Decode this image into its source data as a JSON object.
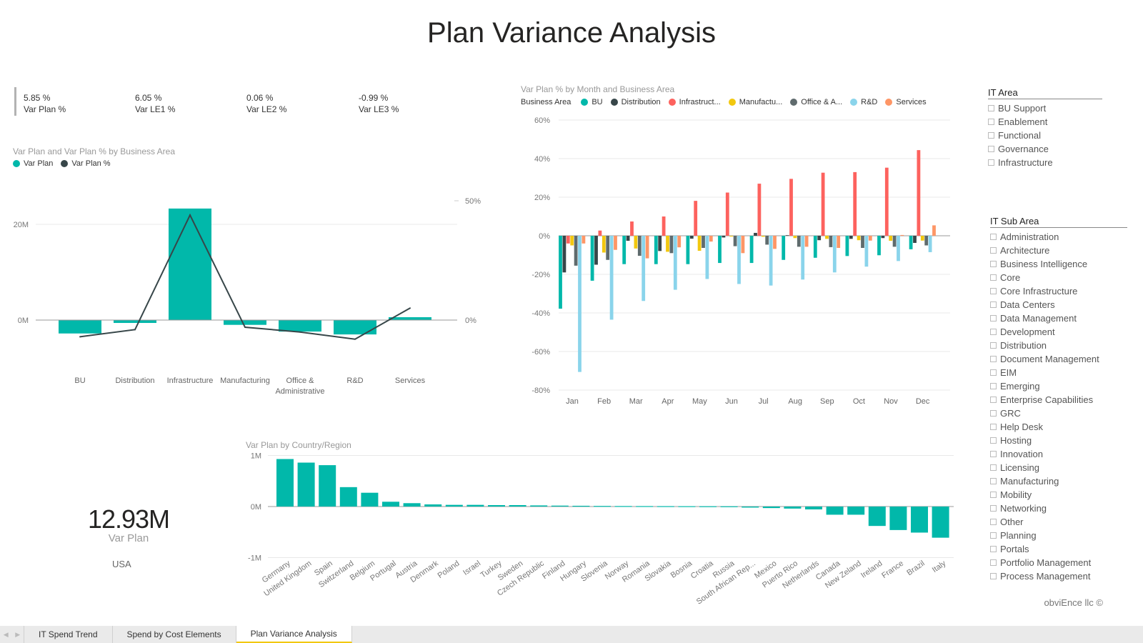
{
  "report": {
    "title": "Plan Variance Analysis",
    "credit": "obviEnce llc ©"
  },
  "colors": {
    "teal": "#01B8AA",
    "dark": "#374649",
    "red": "#FD625E",
    "yellow": "#F2C80F",
    "gray": "#5F6B6D",
    "lightblue": "#8AD4EB",
    "orange": "#FE9666",
    "tab_active": "#F2C811"
  },
  "kpis": [
    {
      "value": "5.85 %",
      "label": "Var Plan %"
    },
    {
      "value": "6.05 %",
      "label": "Var LE1 %"
    },
    {
      "value": "0.06 %",
      "label": "Var LE2 %"
    },
    {
      "value": "-0.99 %",
      "label": "Var LE3 %"
    }
  ],
  "big_card": {
    "value": "12.93M",
    "label": "Var Plan",
    "filter_label": "USA"
  },
  "slicers": {
    "it_area": {
      "title": "IT Area",
      "items": [
        "BU Support",
        "Enablement",
        "Functional",
        "Governance",
        "Infrastructure"
      ]
    },
    "it_sub_area": {
      "title": "IT Sub Area",
      "items": [
        "Administration",
        "Architecture",
        "Business Intelligence",
        "Core",
        "Core Infrastructure",
        "Data Centers",
        "Data Management",
        "Development",
        "Distribution",
        "Document Management",
        "EIM",
        "Emerging",
        "Enterprise Capabilities",
        "GRC",
        "Help Desk",
        "Hosting",
        "Innovation",
        "Licensing",
        "Manufacturing",
        "Mobility",
        "Networking",
        "Other",
        "Planning",
        "Portals",
        "Portfolio Management",
        "Process Management"
      ]
    }
  },
  "tabs": {
    "items": [
      "IT Spend Trend",
      "Spend by Cost Elements",
      "Plan Variance Analysis"
    ],
    "active": 2
  },
  "chart_data": [
    {
      "id": "combo",
      "type": "bar",
      "title": "Var Plan and Var Plan % by Business Area",
      "legend": [
        "Var Plan",
        "Var Plan %"
      ],
      "legend_position": "top-left",
      "categories": [
        "BU",
        "Distribution",
        "Infrastructure",
        "Manufacturing",
        "Office & Administrative",
        "R&D",
        "Services"
      ],
      "category_lines": [
        [
          "BU"
        ],
        [
          "Distribution"
        ],
        [
          "Infrastructure"
        ],
        [
          "Manufacturing"
        ],
        [
          "Office &",
          "Administrative"
        ],
        [
          "R&D"
        ],
        [
          "Services"
        ]
      ],
      "series": [
        {
          "name": "Var Plan",
          "type": "bar",
          "axis": "left",
          "unit": "M",
          "values": [
            -2.8,
            -0.6,
            23.3,
            -1.0,
            -2.4,
            -3.0,
            0.6
          ]
        },
        {
          "name": "Var Plan %",
          "type": "line",
          "axis": "right",
          "unit": "%",
          "values": [
            -7,
            -4,
            44,
            -3,
            -5,
            -8,
            5
          ]
        }
      ],
      "y_left": {
        "ticks": [
          0,
          20
        ],
        "tick_labels": [
          "0M",
          "20M"
        ],
        "range": [
          -12,
          26
        ]
      },
      "y_right": {
        "ticks": [
          0,
          50
        ],
        "tick_labels": [
          "0%",
          "50%"
        ]
      },
      "grid": true
    },
    {
      "id": "monthly",
      "type": "bar",
      "title": "Var Plan % by Month and Business Area",
      "legend_title": "Business Area",
      "legend_position": "top-left",
      "legend": [
        "BU",
        "Distribution",
        "Infrastruct...",
        "Manufactu...",
        "Office & A...",
        "R&D",
        "Services"
      ],
      "categories": [
        "Jan",
        "Feb",
        "Mar",
        "Apr",
        "May",
        "Jun",
        "Jul",
        "Aug",
        "Sep",
        "Oct",
        "Nov",
        "Dec"
      ],
      "series": [
        {
          "name": "BU",
          "values": [
            -37.8,
            -23.3,
            -14.7,
            -14.7,
            -14.7,
            -14.1,
            -14.1,
            -12.5,
            -11.4,
            -10.5,
            -10.1,
            -7.0
          ]
        },
        {
          "name": "Distribution",
          "values": [
            -19.0,
            -15.0,
            -2.6,
            -7.9,
            -1.5,
            -0.9,
            1.5,
            0.3,
            -2.3,
            -1.6,
            -1.2,
            -3.7
          ]
        },
        {
          "name": "Infrastructure",
          "values": [
            -4.0,
            2.7,
            7.4,
            10.0,
            18.1,
            22.4,
            27.0,
            29.5,
            32.7,
            33.0,
            35.3,
            44.4
          ]
        },
        {
          "name": "Manufacturing",
          "values": [
            -5.0,
            -8.7,
            -6.6,
            -8.3,
            -7.8,
            -0.4,
            -0.5,
            -1.2,
            -1.6,
            -2.3,
            -2.6,
            -2.5
          ]
        },
        {
          "name": "Office & Administrative",
          "values": [
            -15.5,
            -12.5,
            -10.4,
            -9.0,
            -6.3,
            -5.4,
            -4.6,
            -5.7,
            -5.9,
            -6.3,
            -5.7,
            -5.0
          ]
        },
        {
          "name": "R&D",
          "values": [
            -70.6,
            -43.5,
            -33.8,
            -28.0,
            -22.4,
            -25.0,
            -25.8,
            -22.7,
            -19.0,
            -16.0,
            -13.1,
            -8.5
          ]
        },
        {
          "name": "Services",
          "values": [
            -4.0,
            -7.3,
            -11.7,
            -6.0,
            -3.0,
            -9.0,
            -6.8,
            -5.7,
            -6.3,
            -2.5,
            0.4,
            5.4
          ]
        }
      ],
      "y": {
        "ticks": [
          60,
          40,
          20,
          0,
          -20,
          -40,
          -60,
          -80
        ],
        "tick_labels": [
          "60%",
          "40%",
          "20%",
          "0%",
          "-20%",
          "-40%",
          "-60%",
          "-80%"
        ],
        "range": [
          -80,
          60
        ]
      },
      "grid": true
    },
    {
      "id": "country",
      "type": "bar",
      "title": "Var Plan by Country/Region",
      "categories": [
        "Germany",
        "United Kingdom",
        "Spain",
        "Switzerland",
        "Belgium",
        "Portugal",
        "Austria",
        "Denmark",
        "Poland",
        "Israel",
        "Turkey",
        "Sweden",
        "Czech Republic",
        "Finland",
        "Hungary",
        "Slovenia",
        "Norway",
        "Romania",
        "Slovakia",
        "Bosnia",
        "Croatia",
        "Russia",
        "South African Rep...",
        "Mexico",
        "Puerto Rico",
        "Netherlands",
        "Canada",
        "New Zeland",
        "Ireland",
        "France",
        "Brazil",
        "Italy"
      ],
      "values": [
        0.93,
        0.86,
        0.81,
        0.38,
        0.27,
        0.094,
        0.066,
        0.042,
        0.033,
        0.033,
        0.028,
        0.028,
        0.022,
        0.018,
        0.015,
        0.012,
        0.01,
        0.009,
        0.008,
        0.007,
        0.006,
        0.005,
        -0.02,
        -0.03,
        -0.04,
        -0.056,
        -0.16,
        -0.16,
        -0.38,
        -0.46,
        -0.51,
        -0.61
      ],
      "unit": "M",
      "y": {
        "ticks": [
          1,
          0,
          -1
        ],
        "tick_labels": [
          "1M",
          "0M",
          "-1M"
        ],
        "range": [
          -1,
          1
        ]
      },
      "grid": true
    }
  ]
}
